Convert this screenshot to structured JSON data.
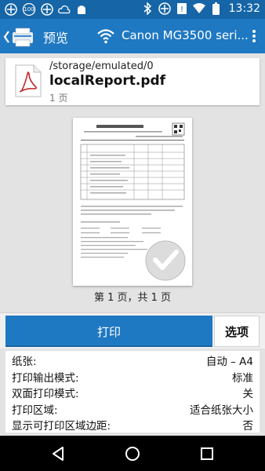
{
  "status_bar": {
    "left_icons": [
      "signal-icon",
      "badge-100-icon",
      "signal-icon",
      "cloud-icon",
      "android-icon"
    ],
    "badge_text": "100",
    "right_icons": [
      "bluetooth-icon",
      "signal-icon",
      "no-sim-icon",
      "wifi-icon",
      "battery-icon"
    ],
    "time": "13:32"
  },
  "app_bar": {
    "title": "预览",
    "printer_name": "Canon MG3500 seri...",
    "menu_icon": "overflow-menu-icon"
  },
  "file": {
    "path": "/storage/emulated/0",
    "name": "localReport.pdf",
    "pages": "1 页"
  },
  "preview": {
    "page_indicator": "第 1 页，共 1 页"
  },
  "actions": {
    "print_label": "打印",
    "options_label": "选项"
  },
  "settings": [
    {
      "label": "纸张:",
      "value": "自动 – A4"
    },
    {
      "label": "打印输出模式:",
      "value": "标准"
    },
    {
      "label": "双面打印模式:",
      "value": "关"
    },
    {
      "label": "打印区域:",
      "value": "适合纸张大小"
    },
    {
      "label": "显示可打印区域边距:",
      "value": "否"
    }
  ],
  "colors": {
    "status_bar": "#1565a7",
    "app_bar": "#1f78c2",
    "print_button": "#1f78c2",
    "pdf_red": "#c62828"
  }
}
